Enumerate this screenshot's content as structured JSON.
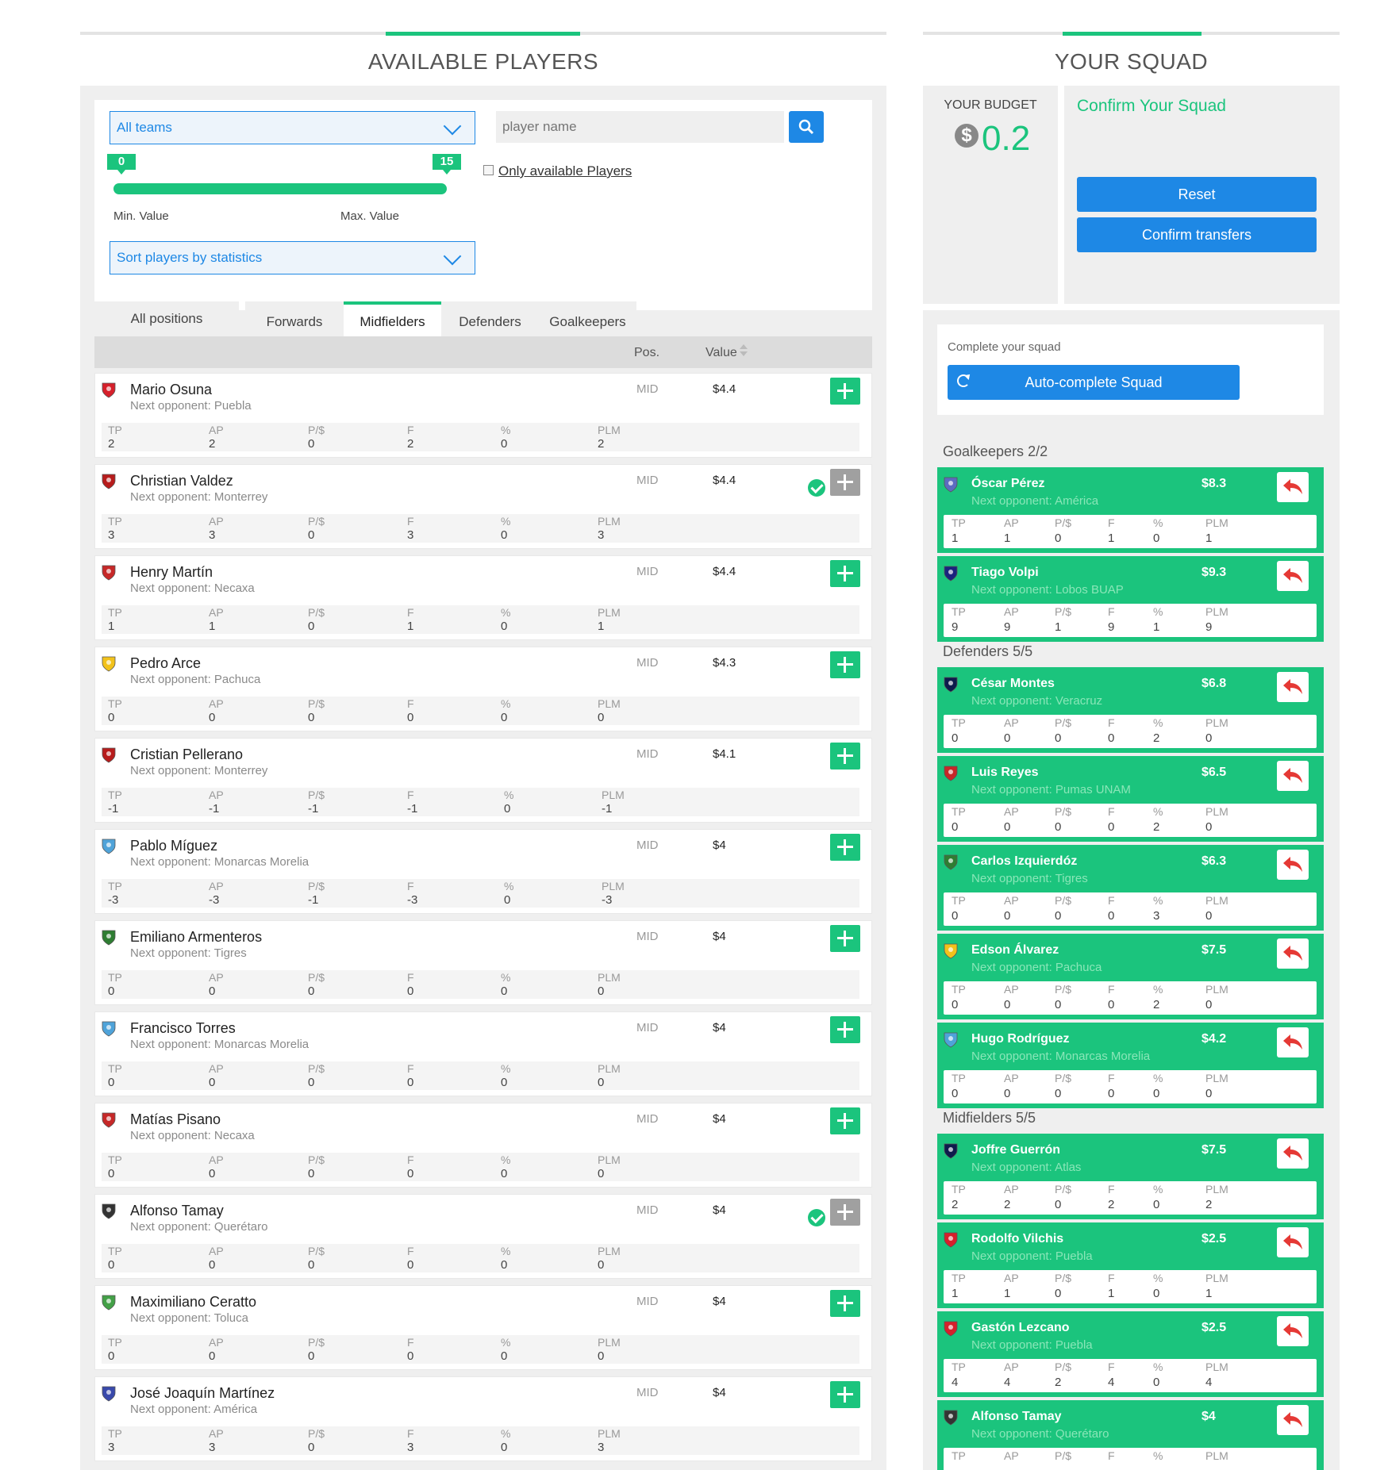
{
  "available_header": "AVAILABLE PLAYERS",
  "squad_header": "YOUR SQUAD",
  "filters": {
    "team_select": "All teams",
    "name_placeholder": "player name",
    "only_available": "Only available Players",
    "min_bubble": "0",
    "max_bubble": "15",
    "min_label": "Min. Value",
    "max_label": "Max. Value",
    "sort_select": "Sort players by statistics"
  },
  "tabs": [
    "All positions",
    "Forwards",
    "Midfielders",
    "Defenders",
    "Goalkeepers"
  ],
  "active_tab": "Midfielders",
  "list_header": {
    "pos": "Pos.",
    "value": "Value"
  },
  "stat_headers": [
    "TP",
    "AP",
    "P/$",
    "F",
    "%",
    "PLM"
  ],
  "players": [
    {
      "name": "Mario Osuna",
      "opponent": "Next opponent: Puebla",
      "pos": "MID",
      "value": "$4.4",
      "in_squad": false,
      "stats": [
        "2",
        "2",
        "0",
        "2",
        "0",
        "2"
      ],
      "crest_color": "#d6202b"
    },
    {
      "name": "Christian Valdez",
      "opponent": "Next opponent: Monterrey",
      "pos": "MID",
      "value": "$4.4",
      "in_squad": true,
      "stats": [
        "3",
        "3",
        "0",
        "3",
        "0",
        "3"
      ],
      "crest_color": "#b71c1c"
    },
    {
      "name": "Henry Martín",
      "opponent": "Next opponent: Necaxa",
      "pos": "MID",
      "value": "$4.4",
      "in_squad": false,
      "stats": [
        "1",
        "1",
        "0",
        "1",
        "0",
        "1"
      ],
      "crest_color": "#c62828"
    },
    {
      "name": "Pedro Arce",
      "opponent": "Next opponent: Pachuca",
      "pos": "MID",
      "value": "$4.3",
      "in_squad": false,
      "stats": [
        "0",
        "0",
        "0",
        "0",
        "0",
        "0"
      ],
      "crest_color": "#f2c21b"
    },
    {
      "name": "Cristian Pellerano",
      "opponent": "Next opponent: Monterrey",
      "pos": "MID",
      "value": "$4.1",
      "in_squad": false,
      "stats": [
        "-1",
        "-1",
        "-1",
        "-1",
        "0",
        "-1"
      ],
      "crest_color": "#b71c1c"
    },
    {
      "name": "Pablo Míguez",
      "opponent": "Next opponent: Monarcas Morelia",
      "pos": "MID",
      "value": "$4",
      "in_squad": false,
      "stats": [
        "-3",
        "-3",
        "-1",
        "-3",
        "0",
        "-3"
      ],
      "crest_color": "#4fa3d9"
    },
    {
      "name": "Emiliano Armenteros",
      "opponent": "Next opponent: Tigres",
      "pos": "MID",
      "value": "$4",
      "in_squad": false,
      "stats": [
        "0",
        "0",
        "0",
        "0",
        "0",
        "0"
      ],
      "crest_color": "#2e7d32"
    },
    {
      "name": "Francisco Torres",
      "opponent": "Next opponent: Monarcas Morelia",
      "pos": "MID",
      "value": "$4",
      "in_squad": false,
      "stats": [
        "0",
        "0",
        "0",
        "0",
        "0",
        "0"
      ],
      "crest_color": "#4fa3d9"
    },
    {
      "name": "Matías Pisano",
      "opponent": "Next opponent: Necaxa",
      "pos": "MID",
      "value": "$4",
      "in_squad": false,
      "stats": [
        "0",
        "0",
        "0",
        "0",
        "0",
        "0"
      ],
      "crest_color": "#c62828"
    },
    {
      "name": "Alfonso Tamay",
      "opponent": "Next opponent: Querétaro",
      "pos": "MID",
      "value": "$4",
      "in_squad": true,
      "stats": [
        "0",
        "0",
        "0",
        "0",
        "0",
        "0"
      ],
      "crest_color": "#333333"
    },
    {
      "name": "Maximiliano Ceratto",
      "opponent": "Next opponent: Toluca",
      "pos": "MID",
      "value": "$4",
      "in_squad": false,
      "stats": [
        "0",
        "0",
        "0",
        "0",
        "0",
        "0"
      ],
      "crest_color": "#43a047"
    },
    {
      "name": "José Joaquín Martínez",
      "opponent": "Next opponent: América",
      "pos": "MID",
      "value": "$4",
      "in_squad": false,
      "stats": [
        "3",
        "3",
        "0",
        "3",
        "0",
        "3"
      ],
      "crest_color": "#3949ab"
    }
  ],
  "budget": {
    "label": "YOUR BUDGET",
    "amount": "0.2",
    "coin": "$"
  },
  "confirm": {
    "title": "Confirm Your Squad",
    "reset": "Reset",
    "confirm_transfers": "Confirm transfers"
  },
  "complete": {
    "label": "Complete your squad",
    "auto": "Auto-complete Squad"
  },
  "groups": [
    {
      "title": "Goalkeepers",
      "count": "2/2",
      "cards": [
        {
          "name": "Óscar Pérez",
          "opponent": "Next opponent: América",
          "value": "$8.3",
          "stats": [
            "1",
            "1",
            "0",
            "1",
            "0",
            "1"
          ],
          "crest_color": "#5c6bc0"
        },
        {
          "name": "Tiago Volpi",
          "opponent": "Next opponent: Lobos BUAP",
          "value": "$9.3",
          "stats": [
            "9",
            "9",
            "1",
            "9",
            "1",
            "9"
          ],
          "crest_color": "#1a237e"
        }
      ]
    },
    {
      "title": "Defenders",
      "count": "5/5",
      "cards": [
        {
          "name": "César Montes",
          "opponent": "Next opponent: Veracruz",
          "value": "$6.8",
          "stats": [
            "0",
            "0",
            "0",
            "0",
            "2",
            "0"
          ],
          "crest_color": "#0d1b4c"
        },
        {
          "name": "Luis Reyes",
          "opponent": "Next opponent: Pumas UNAM",
          "value": "$6.5",
          "stats": [
            "0",
            "0",
            "0",
            "0",
            "2",
            "0"
          ],
          "crest_color": "#c62828"
        },
        {
          "name": "Carlos Izquierdóz",
          "opponent": "Next opponent: Tigres",
          "value": "$6.3",
          "stats": [
            "0",
            "0",
            "0",
            "0",
            "3",
            "0"
          ],
          "crest_color": "#2e7d32"
        },
        {
          "name": "Edson Álvarez",
          "opponent": "Next opponent: Pachuca",
          "value": "$7.5",
          "stats": [
            "0",
            "0",
            "0",
            "0",
            "2",
            "0"
          ],
          "crest_color": "#f2c21b"
        },
        {
          "name": "Hugo Rodríguez",
          "opponent": "Next opponent: Monarcas Morelia",
          "value": "$4.2",
          "stats": [
            "0",
            "0",
            "0",
            "0",
            "0",
            "0"
          ],
          "crest_color": "#4fa3d9"
        }
      ]
    },
    {
      "title": "Midfielders",
      "count": "5/5",
      "cards": [
        {
          "name": "Joffre Guerrón",
          "opponent": "Next opponent: Atlas",
          "value": "$7.5",
          "stats": [
            "2",
            "2",
            "0",
            "2",
            "0",
            "2"
          ],
          "crest_color": "#0d1b4c"
        },
        {
          "name": "Rodolfo Vilchis",
          "opponent": "Next opponent: Puebla",
          "value": "$2.5",
          "stats": [
            "1",
            "1",
            "0",
            "1",
            "0",
            "1"
          ],
          "crest_color": "#d6202b"
        },
        {
          "name": "Gastón Lezcano",
          "opponent": "Next opponent: Puebla",
          "value": "$2.5",
          "stats": [
            "4",
            "4",
            "2",
            "4",
            "0",
            "4"
          ],
          "crest_color": "#d6202b"
        },
        {
          "name": "Alfonso Tamay",
          "opponent": "Next opponent: Querétaro",
          "value": "$4",
          "stats": [
            "",
            "",
            "",
            "",
            "",
            ""
          ],
          "crest_color": "#333333"
        }
      ]
    }
  ]
}
